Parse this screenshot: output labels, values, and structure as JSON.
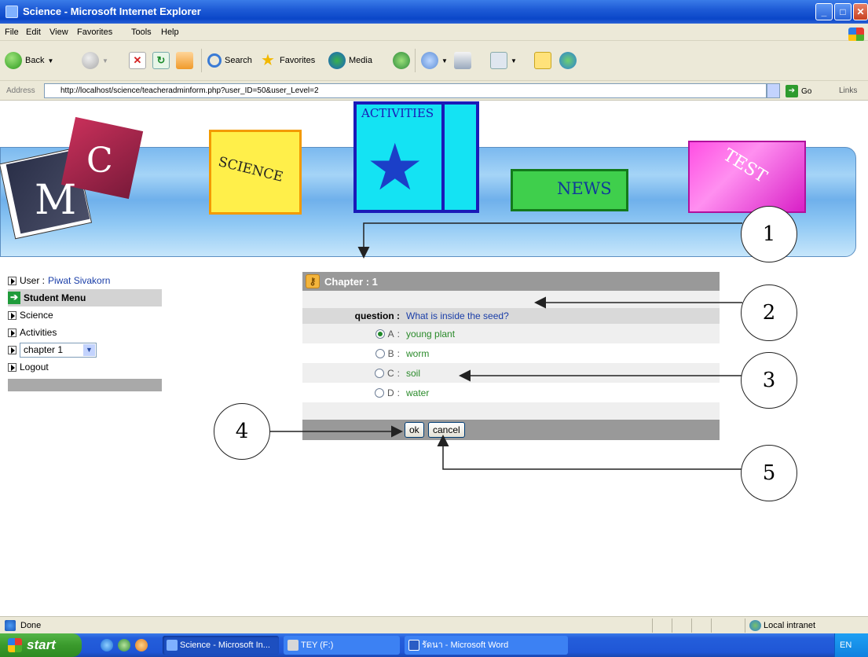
{
  "window": {
    "title": "Science - Microsoft Internet Explorer",
    "controls": {
      "min": "_",
      "max": "□",
      "close": "✕"
    }
  },
  "menubar": [
    "File",
    "Edit",
    "View",
    "Favorites",
    "Tools",
    "Help"
  ],
  "toolbar": {
    "back_label": "Back",
    "search_label": "Search",
    "favorites_label": "Favorites",
    "media_label": "Media"
  },
  "address": {
    "label": "Address",
    "url": "http://localhost/science/teacheradminform.php?user_ID=50&user_Level=2",
    "go_label": "Go",
    "links_label": "Links"
  },
  "banner": {
    "logo_m": "M",
    "logo_c": "C",
    "books": [
      "SCIENCE",
      "ACTIVITIES",
      "NEWS",
      "TEST"
    ]
  },
  "sidebar": {
    "user_prefix": "User :",
    "user_name": "Piwat Sivakorn",
    "menu_title": "Student Menu",
    "items": [
      "Science",
      "Activities"
    ],
    "chapter_select": "chapter 1",
    "logout": "Logout"
  },
  "quiz": {
    "header": "Chapter : 1",
    "question_label": "question :",
    "question": "What is inside the seed?",
    "options": [
      {
        "letter": "A",
        "text": "young plant",
        "selected": true
      },
      {
        "letter": "B",
        "text": "worm",
        "selected": false
      },
      {
        "letter": "C",
        "text": "soil",
        "selected": false
      },
      {
        "letter": "D",
        "text": "water",
        "selected": false
      }
    ],
    "ok_label": "ok",
    "cancel_label": "cancel"
  },
  "annotations": [
    "1",
    "2",
    "3",
    "4",
    "5"
  ],
  "statusbar": {
    "status": "Done",
    "zone": "Local intranet"
  },
  "taskbar": {
    "start": "start",
    "tasks": [
      "Science - Microsoft In...",
      "TEY (F:)",
      "รัดนา - Microsoft Word"
    ],
    "lang": "EN"
  }
}
